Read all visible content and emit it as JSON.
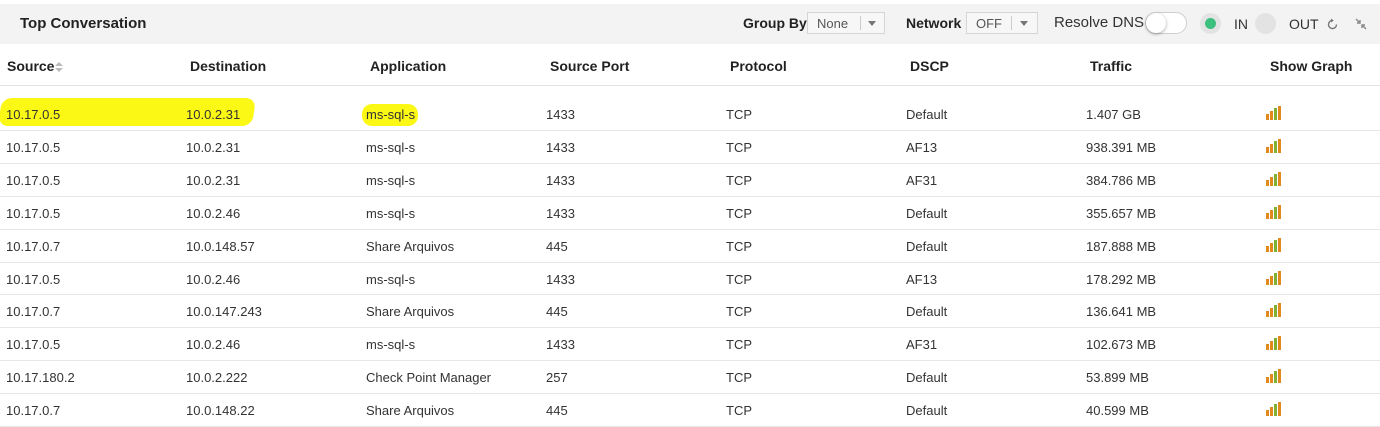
{
  "panel": {
    "title": "Top Conversation",
    "group_by": {
      "label": "Group By",
      "value": "None"
    },
    "network": {
      "label": "Network",
      "value": "OFF"
    },
    "resolve_dns": {
      "label": "Resolve DNS",
      "enabled": false
    },
    "direction": {
      "in_label": "IN",
      "out_label": "OUT",
      "selected": "IN"
    }
  },
  "columns": [
    "Source",
    "Destination",
    "Application",
    "Source Port",
    "Protocol",
    "DSCP",
    "Traffic",
    "Show Graph"
  ],
  "rows": [
    {
      "source": "10.17.0.5",
      "destination": "10.0.2.31",
      "application": "ms-sql-s",
      "source_port": "1433",
      "protocol": "TCP",
      "dscp": "Default",
      "traffic": "1.407 GB"
    },
    {
      "source": "10.17.0.5",
      "destination": "10.0.2.31",
      "application": "ms-sql-s",
      "source_port": "1433",
      "protocol": "TCP",
      "dscp": "AF13",
      "traffic": "938.391 MB"
    },
    {
      "source": "10.17.0.5",
      "destination": "10.0.2.31",
      "application": "ms-sql-s",
      "source_port": "1433",
      "protocol": "TCP",
      "dscp": "AF31",
      "traffic": "384.786 MB"
    },
    {
      "source": "10.17.0.5",
      "destination": "10.0.2.46",
      "application": "ms-sql-s",
      "source_port": "1433",
      "protocol": "TCP",
      "dscp": "Default",
      "traffic": "355.657 MB"
    },
    {
      "source": "10.17.0.7",
      "destination": "10.0.148.57",
      "application": "Share Arquivos",
      "source_port": "445",
      "protocol": "TCP",
      "dscp": "Default",
      "traffic": "187.888 MB"
    },
    {
      "source": "10.17.0.5",
      "destination": "10.0.2.46",
      "application": "ms-sql-s",
      "source_port": "1433",
      "protocol": "TCP",
      "dscp": "AF13",
      "traffic": "178.292 MB"
    },
    {
      "source": "10.17.0.7",
      "destination": "10.0.147.243",
      "application": "Share Arquivos",
      "source_port": "445",
      "protocol": "TCP",
      "dscp": "Default",
      "traffic": "136.641 MB"
    },
    {
      "source": "10.17.0.5",
      "destination": "10.0.2.46",
      "application": "ms-sql-s",
      "source_port": "1433",
      "protocol": "TCP",
      "dscp": "AF31",
      "traffic": "102.673 MB"
    },
    {
      "source": "10.17.180.2",
      "destination": "10.0.2.222",
      "application": "Check Point Manager",
      "source_port": "257",
      "protocol": "TCP",
      "dscp": "Default",
      "traffic": "53.899 MB"
    },
    {
      "source": "10.17.0.7",
      "destination": "10.0.148.22",
      "application": "Share Arquivos",
      "source_port": "445",
      "protocol": "TCP",
      "dscp": "Default",
      "traffic": "40.599 MB"
    }
  ],
  "icons": {
    "refresh": "refresh-icon",
    "collapse": "collapse-icon",
    "sort": "sort-icon",
    "graph": "bar-chart-icon"
  },
  "colors": {
    "highlight": "#fcf815",
    "in_selected": "#3dbf7d",
    "graph_orange": "#e08a1e",
    "graph_green": "#7fb135"
  }
}
